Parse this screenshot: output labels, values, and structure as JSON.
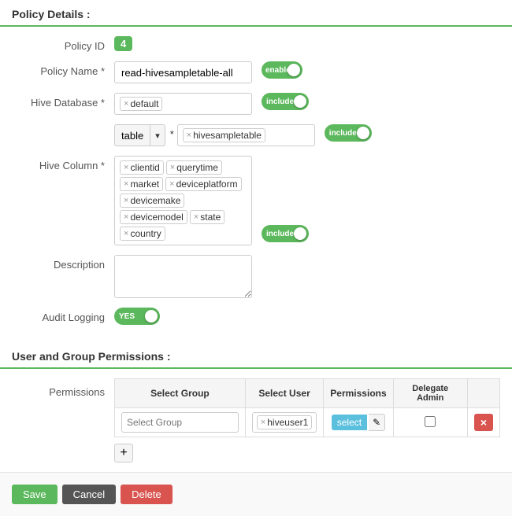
{
  "page": {
    "policy_details_header": "Policy Details :",
    "user_group_permissions_header": "User and Group Permissions :"
  },
  "policy_id": {
    "label": "Policy ID",
    "value": "4"
  },
  "policy_name": {
    "label": "Policy Name *",
    "value": "read-hivesampletable-all",
    "toggle": "enabled"
  },
  "hive_database": {
    "label": "Hive Database *",
    "tag": "default",
    "toggle": "include"
  },
  "hive_table": {
    "dropdown_label": "table",
    "label": " *",
    "tag": "hivesampletable",
    "toggle": "include"
  },
  "hive_column": {
    "label": "Hive Column *",
    "tags": [
      "clientid",
      "querytime",
      "market",
      "deviceplatform",
      "devicemake",
      "devicemodel",
      "state",
      "country"
    ],
    "toggle": "include"
  },
  "description": {
    "label": "Description",
    "placeholder": ""
  },
  "audit_logging": {
    "label": "Audit Logging",
    "toggle": "YES"
  },
  "permissions": {
    "label": "Permissions",
    "table_headers": {
      "select_group": "Select Group",
      "select_user": "Select User",
      "permissions": "Permissions",
      "delegate_admin": "Delegate Admin"
    },
    "rows": [
      {
        "group_placeholder": "Select Group",
        "user_tag": "hiveuser1",
        "permissions_btn": "select",
        "delegate": false
      }
    ]
  },
  "buttons": {
    "save": "Save",
    "cancel": "Cancel",
    "delete": "Delete",
    "add_row": "+",
    "delete_row": "×"
  }
}
